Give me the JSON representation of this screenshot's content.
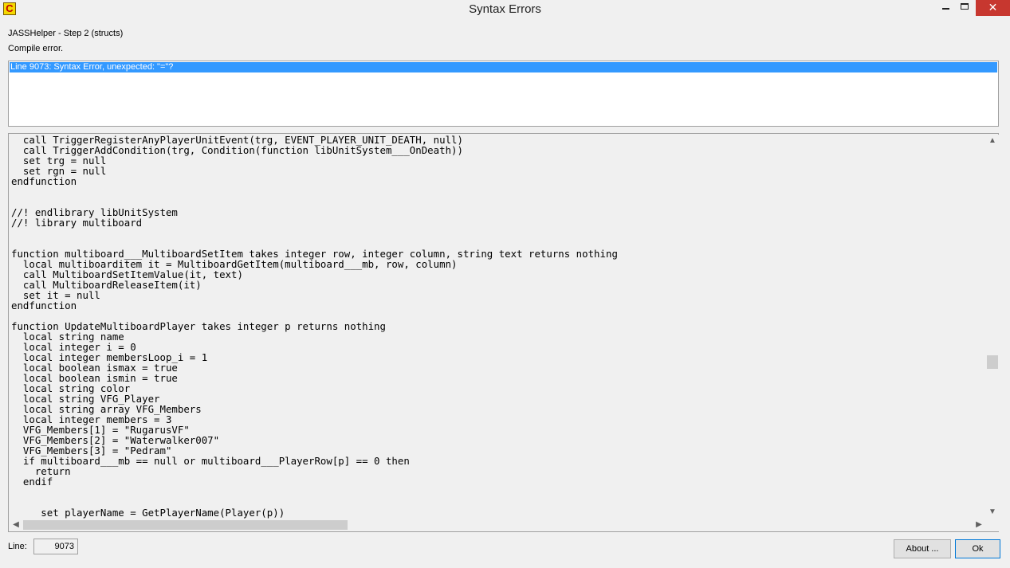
{
  "window": {
    "title": "Syntax Errors",
    "icon_letter": "C",
    "icon": "app-c-icon",
    "controls": {
      "minimize": "minimize-icon",
      "maximize": "maximize-icon",
      "close": "close-icon"
    }
  },
  "header": {
    "step_label": "JASSHelper - Step 2 (structs)",
    "status_label": "Compile error."
  },
  "errors": [
    {
      "text": "Line 9073: Syntax Error, unexpected: \"=\"?",
      "selected": true
    }
  ],
  "code_lines": [
    "  call TriggerRegisterAnyPlayerUnitEvent(trg, EVENT_PLAYER_UNIT_DEATH, null)",
    "  call TriggerAddCondition(trg, Condition(function libUnitSystem___OnDeath))",
    "  set trg = null",
    "  set rgn = null",
    "endfunction",
    "",
    "",
    "//! endlibrary libUnitSystem",
    "//! library multiboard",
    "",
    "",
    "function multiboard___MultiboardSetItem takes integer row, integer column, string text returns nothing",
    "  local multiboarditem it = MultiboardGetItem(multiboard___mb, row, column)",
    "  call MultiboardSetItemValue(it, text)",
    "  call MultiboardReleaseItem(it)",
    "  set it = null",
    "endfunction",
    "",
    "function UpdateMultiboardPlayer takes integer p returns nothing",
    "  local string name",
    "  local integer i = 0",
    "  local integer membersLoop_i = 1",
    "  local boolean ismax = true",
    "  local boolean ismin = true",
    "  local string color",
    "  local string VFG_Player",
    "  local string array VFG_Members",
    "  local integer members = 3",
    "  VFG_Members[1] = \"RugarusVF\"",
    "  VFG_Members[2] = \"Waterwalker007\"",
    "  VFG_Members[3] = \"Pedram\"",
    "  if multiboard___mb == null or multiboard___PlayerRow[p] == 0 then",
    "    return",
    "  endif",
    "",
    "",
    "     set playerName = GetPlayerName(Player(p))"
  ],
  "scrollbars": {
    "up": "▲",
    "down": "▼",
    "left": "◀",
    "right": "▶"
  },
  "footer": {
    "line_label": "Line:",
    "line_value": "9073",
    "about_button": "About ...",
    "ok_button": "Ok"
  }
}
